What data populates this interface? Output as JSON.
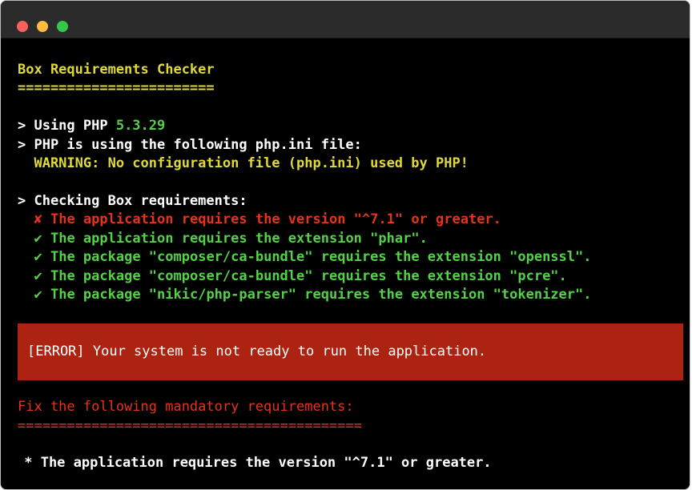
{
  "window": {
    "controls": [
      "close",
      "minimize",
      "maximize"
    ]
  },
  "terminal": {
    "title": "Box Requirements Checker",
    "title_underline": "========================",
    "php_prompt": "> Using PHP ",
    "php_version": "5.3.29",
    "ini_prompt": "> PHP is using the following php.ini file:",
    "ini_warning": "  WARNING: No configuration file (php.ini) used by PHP!",
    "checking_prompt": "> Checking Box requirements:",
    "requirements": [
      {
        "status": "fail",
        "icon": "✘",
        "text": "The application requires the version \"^7.1\" or greater."
      },
      {
        "status": "pass",
        "icon": "✔",
        "text": "The application requires the extension \"phar\"."
      },
      {
        "status": "pass",
        "icon": "✔",
        "text": "The package \"composer/ca-bundle\" requires the extension \"openssl\"."
      },
      {
        "status": "pass",
        "icon": "✔",
        "text": "The package \"composer/ca-bundle\" requires the extension \"pcre\"."
      },
      {
        "status": "pass",
        "icon": "✔",
        "text": "The package \"nikic/php-parser\" requires the extension \"tokenizer\"."
      }
    ],
    "error_message": "[ERROR] Your system is not ready to run the application.",
    "fix_heading": "Fix the following mandatory requirements:",
    "fix_underline": "==========================================",
    "fix_items": [
      " * The application requires the version \"^7.1\" or greater."
    ]
  },
  "colors": {
    "background": "#000000",
    "title_yellow": "#e0d93a",
    "pass_green": "#53d247",
    "fail_red": "#e7321c",
    "error_block": "#ad2312",
    "close_dot": "#fc605c",
    "minimize_dot": "#fdbc40",
    "maximize_dot": "#34c84a"
  }
}
